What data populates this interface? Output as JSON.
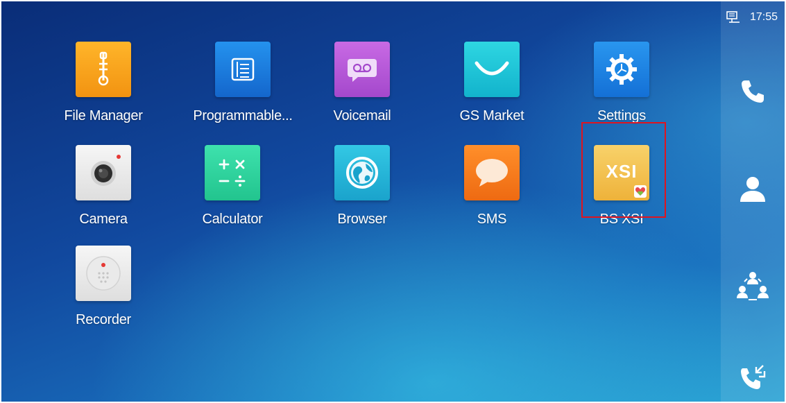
{
  "status_bar": {
    "time": "17:55",
    "network_icon": "ethernet-icon"
  },
  "apps": [
    {
      "id": "file-manager",
      "label": "File Manager",
      "icon": "file-manager-icon",
      "color": "#f5a21b"
    },
    {
      "id": "programmable",
      "label": "Programmable...",
      "icon": "programmable-keys-icon",
      "color": "#1b7fe0"
    },
    {
      "id": "voicemail",
      "label": "Voicemail",
      "icon": "voicemail-icon",
      "color": "#b658d6"
    },
    {
      "id": "gs-market",
      "label": "GS Market",
      "icon": "gs-market-icon",
      "color": "#1fc7d6"
    },
    {
      "id": "settings",
      "label": "Settings",
      "icon": "gear-icon",
      "color": "#1a86e6"
    },
    {
      "id": "camera",
      "label": "Camera",
      "icon": "camera-icon",
      "color": "#ececec"
    },
    {
      "id": "calculator",
      "label": "Calculator",
      "icon": "calculator-icon",
      "color": "#2fd6a0"
    },
    {
      "id": "browser",
      "label": "Browser",
      "icon": "globe-icon",
      "color": "#27b9d8"
    },
    {
      "id": "sms",
      "label": "SMS",
      "icon": "chat-bubble-icon",
      "color": "#f37a1f"
    },
    {
      "id": "bs-xsi",
      "label": "BS XSI",
      "icon": "xsi-icon",
      "icon_text": "XSI",
      "color": "#f2c14c"
    },
    {
      "id": "recorder",
      "label": "Recorder",
      "icon": "recorder-icon",
      "color": "#ececec"
    }
  ],
  "dock": [
    {
      "id": "phone",
      "icon": "phone-icon"
    },
    {
      "id": "contacts",
      "icon": "contact-icon"
    },
    {
      "id": "conference",
      "icon": "conference-icon"
    },
    {
      "id": "call-history",
      "icon": "call-history-icon"
    }
  ],
  "highlight": {
    "target": "bs-xsi",
    "color": "#e0141e"
  }
}
